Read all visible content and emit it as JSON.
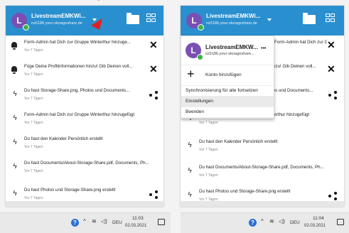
{
  "account": {
    "initial": "L",
    "name": "LivestreamEMKWi...",
    "server": "nx5186.your-storageshare.de"
  },
  "notifications": [
    {
      "icon": "bell-icon",
      "title": "Form-Admin hat Dich zur Gruppe Winterthur hinzuge...",
      "time": "Vor 7 Tagen",
      "action": "dismiss"
    },
    {
      "icon": "bell-icon",
      "title": "Füge Deine Profilinformationen hinzu! Gib Deinen voll...",
      "time": "Vor 7 Tagen",
      "action": "dismiss"
    },
    {
      "icon": "flash-icon",
      "title": "Du hast Storage-Share.png, Photos und Documents...",
      "time": "Vor 7 Tagen",
      "action": "share"
    },
    {
      "icon": "flash-icon",
      "title": "Form-Admin hat Dich zur Gruppe Winterthur hinzugefügt",
      "time": "Vor 7 Tagen",
      "action": ""
    },
    {
      "icon": "flash-icon",
      "title": "Du hast den Kalender Persönlich erstellt",
      "time": "Vor 7 Tagen",
      "action": ""
    },
    {
      "icon": "flash-icon",
      "title": "Du hast Documents/About-Storage-Share.pdf, Documents, Ph...",
      "time": "Vor 7 Tagen",
      "action": ""
    },
    {
      "icon": "flash-icon",
      "title": "Du hast Photos und Storage-Share.png erstellt",
      "time": "Vor 7 Tagen",
      "action": "share"
    }
  ],
  "right_notifications": [
    {
      "title": "Form-Admin hat Dich zur Gruppe Winterthur hinzugefügt",
      "time": "Vor 7 Tagen"
    },
    {
      "title": "Du hast den Kalender Persönlich erstellt",
      "time": "Vor 7 Tagen"
    },
    {
      "title": "Du hast Documents/About-Storage-Share.pdf, Documents, Ph...",
      "time": "Vor 7 Tagen"
    },
    {
      "title": "Du hast Photos und Storage-Share.png erstellt",
      "time": "Vor 7 Tagen"
    }
  ],
  "right_partial": [
    {
      "title": "rozu! Gib Deinen voll...",
      "time": ""
    },
    {
      "title": "tos und Documents...",
      "time": ""
    }
  ],
  "menu": {
    "account_name": "LivestreamEMKW...",
    "account_server": "nx5186.your-storageshare...",
    "more": "•••",
    "add_account": "Konto hinzufügen",
    "resume_sync": "Synchronisierung für alle fortsetzen",
    "settings": "Einstellungen",
    "quit": "Beenden"
  },
  "taskbar_left": {
    "lang": "DEU",
    "time": "11:03",
    "date": "02.03.2021"
  },
  "taskbar_right": {
    "lang": "DEU",
    "time": "11:04",
    "date": "02.03.2021"
  },
  "colors": {
    "header": "#2a8fcf",
    "avatar": "#7a4fb4",
    "online": "#3bb34a",
    "arrow": "#e02020"
  }
}
